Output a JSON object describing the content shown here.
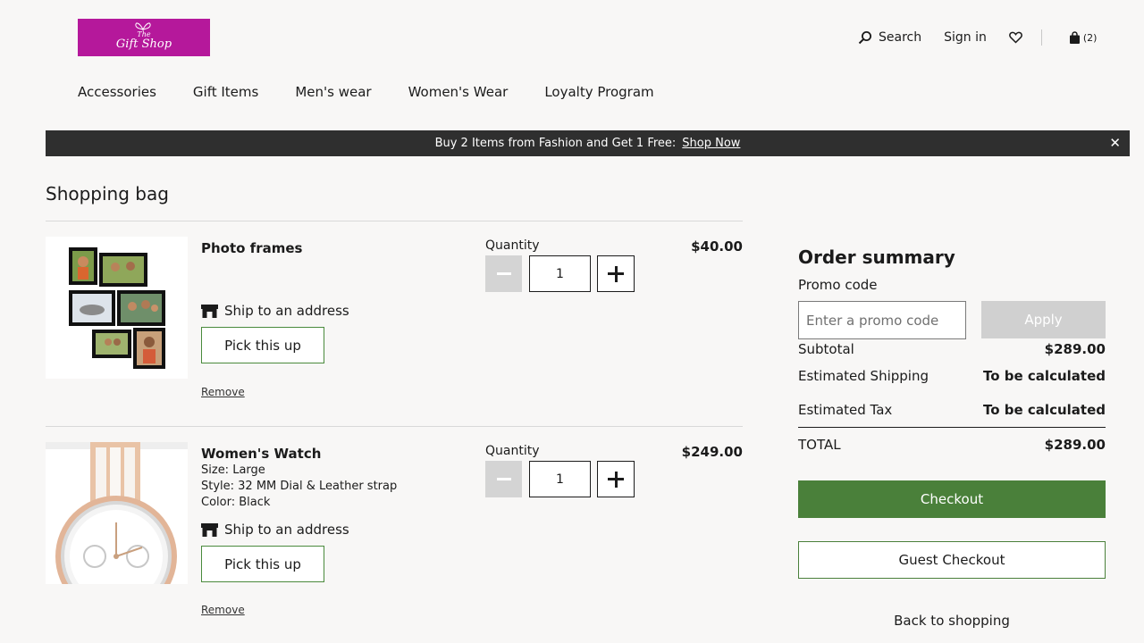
{
  "brand": {
    "logo_text_small": "The",
    "logo_text": "Gift Shop",
    "logo_color": "#b5189b"
  },
  "header": {
    "search_label": "Search",
    "signin_label": "Sign in",
    "bag_count": "(2)"
  },
  "nav": {
    "items": [
      {
        "label": "Accessories"
      },
      {
        "label": "Gift Items"
      },
      {
        "label": "Men's wear"
      },
      {
        "label": "Women's Wear"
      },
      {
        "label": "Loyalty Program"
      }
    ]
  },
  "banner": {
    "text": "Buy 2 Items from Fashion and Get 1 Free:",
    "link": "Shop Now",
    "close": "✕"
  },
  "page_title": "Shopping bag",
  "cart": {
    "items": [
      {
        "name": "Photo frames",
        "image": "photo-frames",
        "attributes": [],
        "ship_label": "Ship to an address",
        "pickup_label": "Pick this up",
        "remove_label": "Remove",
        "quantity_label": "Quantity",
        "quantity": "1",
        "price": "$40.00"
      },
      {
        "name": "Women's Watch",
        "image": "womens-watch",
        "attributes": [
          "Size: Large",
          "Style: 32 MM Dial & Leather strap",
          "Color: Black"
        ],
        "ship_label": "Ship to an address",
        "pickup_label": "Pick this up",
        "remove_label": "Remove",
        "quantity_label": "Quantity",
        "quantity": "1",
        "price": "$249.00"
      }
    ]
  },
  "summary": {
    "title": "Order summary",
    "promo_label": "Promo code",
    "promo_placeholder": "Enter a promo code",
    "apply_label": "Apply",
    "subtotal_label": "Subtotal",
    "subtotal_value": "$289.00",
    "shipping_label": "Estimated Shipping",
    "shipping_value": "To be calculated",
    "tax_label": "Estimated Tax",
    "tax_value": "To be calculated",
    "total_label": "TOTAL",
    "total_value": "$289.00",
    "checkout_label": "Checkout",
    "guest_label": "Guest Checkout",
    "back_label": "Back to shopping"
  },
  "colors": {
    "accent_green": "#4a803a",
    "banner_bg": "#2f2f2f",
    "disabled": "#d0d0d0"
  }
}
